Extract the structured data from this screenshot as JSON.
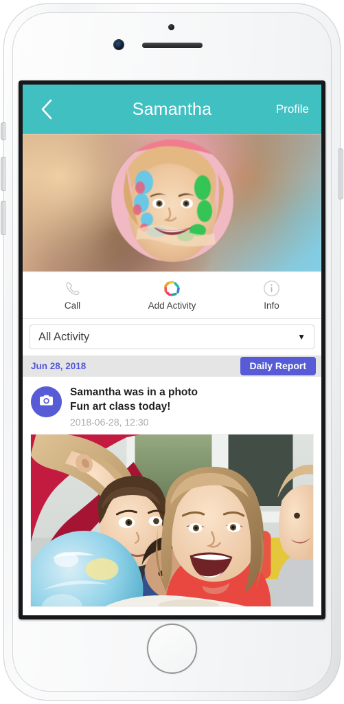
{
  "device": {
    "name": "white-smartphone",
    "hardware": {
      "front_camera": "front-camera",
      "proximity_sensor": "proximity-sensor",
      "earpiece_speaker": "earpiece-speaker",
      "home_button": "home-button",
      "silent_switch": "silent-switch",
      "volume_up": "volume-up-button",
      "volume_down": "volume-down-button",
      "power_button": "power-button"
    }
  },
  "colors": {
    "header_teal": "#41c0c2",
    "accent_blue": "#575cd6",
    "date_label_blue": "#5156d6",
    "date_row_gray": "#e5e5e6",
    "screen_white": "#ffffff",
    "icon_gray": "#bdbec0",
    "body_text": "#1d1e20",
    "timestamp_gray": "#aaabad"
  },
  "header": {
    "back_icon": "chevron-left-icon",
    "title": "Samantha",
    "profile_label": "Profile"
  },
  "hero": {
    "avatar_alt": "child-with-face-paint",
    "background_alt": "blurred-classroom-background"
  },
  "action_bar": {
    "items": [
      {
        "label": "Call",
        "icon": "phone-icon"
      },
      {
        "label": "Add Activity",
        "icon": "activity-pinwheel-icon"
      },
      {
        "label": "Info",
        "icon": "info-circle-icon"
      }
    ]
  },
  "filter": {
    "selected": "All Activity",
    "caret_icon": "chevron-down-icon",
    "options": [
      "All Activity"
    ]
  },
  "feed": {
    "date_label": "Jun 28, 2018",
    "daily_report_label": "Daily Report",
    "entry": {
      "icon": "camera-icon",
      "title": "Samantha was in a photo",
      "message": "Fun art class today!",
      "timestamp": "2018-06-28, 12:30",
      "photo_alt": "children-looking-at-globe-in-classroom"
    }
  }
}
